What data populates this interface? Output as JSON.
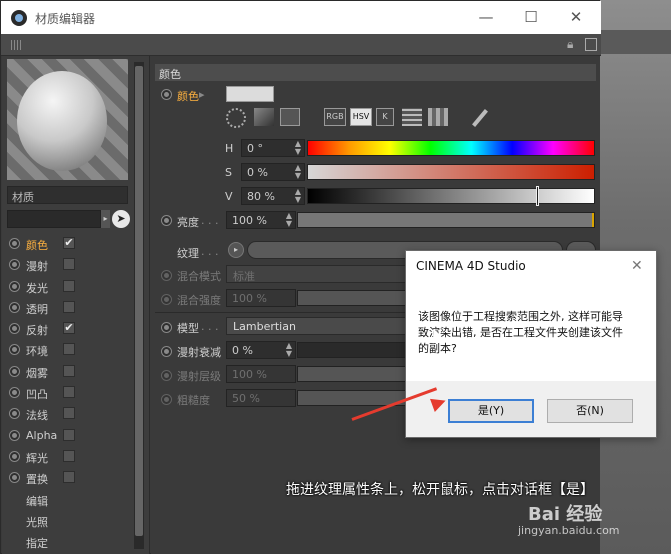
{
  "window": {
    "title": "材质编辑器",
    "controls": {
      "minimize": "—",
      "maximize": "☐",
      "close": "✕"
    }
  },
  "material": {
    "name": "材质"
  },
  "channels": [
    {
      "label": "颜色",
      "checked": true,
      "active": true
    },
    {
      "label": "漫射",
      "checked": false
    },
    {
      "label": "发光",
      "checked": false
    },
    {
      "label": "透明",
      "checked": false
    },
    {
      "label": "反射",
      "checked": true
    },
    {
      "label": "环境",
      "checked": false
    },
    {
      "label": "烟雾",
      "checked": false
    },
    {
      "label": "凹凸",
      "checked": false
    },
    {
      "label": "法线",
      "checked": false
    },
    {
      "label": "Alpha",
      "checked": false
    },
    {
      "label": "辉光",
      "checked": false
    },
    {
      "label": "置换",
      "checked": false
    }
  ],
  "extra_items": [
    "编辑",
    "光照",
    "指定"
  ],
  "color_section": {
    "header": "颜色",
    "color_label": "颜色",
    "swatch_color": "#dcdcdc",
    "modes": [
      "RGB",
      "HSV",
      "K"
    ],
    "selected_mode": "HSV",
    "h_label": "H",
    "h_value": "0 °",
    "s_label": "S",
    "s_value": "0 %",
    "v_label": "V",
    "v_value": "80 %",
    "brightness_label": "亮度",
    "brightness_value": "100 %",
    "brightness_fraction": 1.0,
    "texture_label": "纹理",
    "blend_mode_label": "混合模式",
    "blend_mode_value": "标准",
    "blend_strength_label": "混合强度",
    "blend_strength_value": "100 %",
    "model_label": "模型",
    "model_value": "Lambertian",
    "diffuse_falloff_label": "漫射衰减",
    "diffuse_falloff_value": "0 %",
    "diffuse_level_label": "漫射层级",
    "diffuse_level_value": "100 %",
    "roughness_label": "粗糙度",
    "roughness_value": "50 %"
  },
  "dialog": {
    "title": "CINEMA 4D Studio",
    "message": "该图像位于工程搜索范围之外, 这样可能导致渲染出错, 是否在工程文件夹创建该文件的副本?",
    "yes_label": "是(Y)",
    "no_label": "否(N)",
    "close": "✕"
  },
  "caption": "拖进纹理属性条上，松开鼠标，点击对话框【是】",
  "watermark": {
    "brand": "Bai 经验",
    "url": "jingyan.baidu.com"
  },
  "colors": {
    "accent": "#ffb23f",
    "arrow": "#e53b2e",
    "dialog_default": "#3c7fd4"
  }
}
